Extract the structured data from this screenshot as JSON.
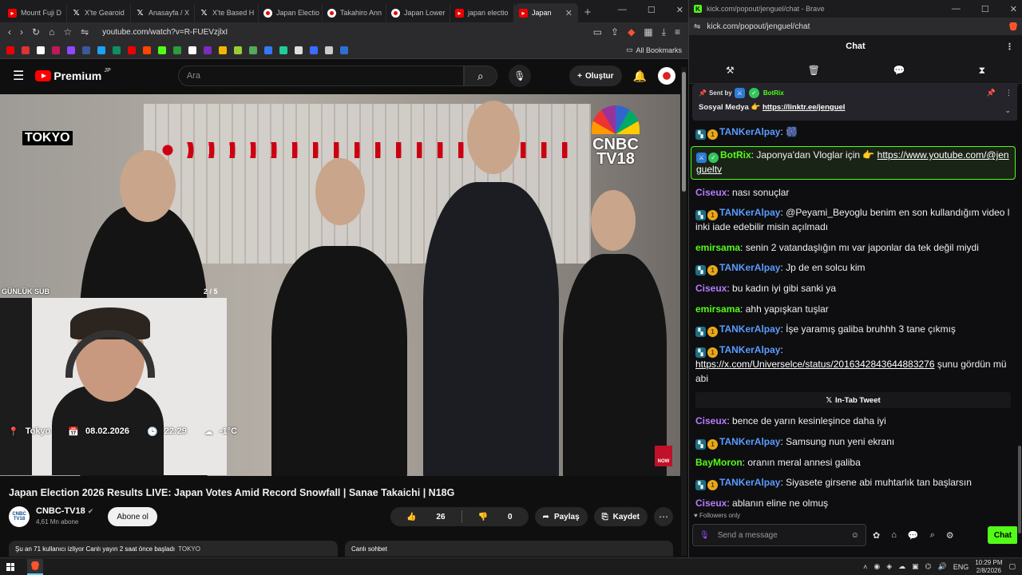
{
  "left_browser": {
    "tabs": [
      {
        "label": "Mount Fuji D",
        "icon": "youtube-icon"
      },
      {
        "label": "X'te Gearoid",
        "icon": "x-icon"
      },
      {
        "label": "Anasayfa / X",
        "icon": "x-icon"
      },
      {
        "label": "X'te Based H",
        "icon": "x-icon"
      },
      {
        "label": "Japan Electio",
        "icon": "japan-flag-icon"
      },
      {
        "label": "Takahiro Ann",
        "icon": "japan-flag-icon"
      },
      {
        "label": "Japan Lower",
        "icon": "japan-flag-icon"
      },
      {
        "label": "japan electio",
        "icon": "youtube-icon"
      },
      {
        "label": "Japan",
        "icon": "youtube-icon",
        "active": true
      }
    ],
    "url": "youtube.com/watch?v=R-FUEVzjlxI",
    "all_bookmarks": "All Bookmarks"
  },
  "youtube": {
    "logo_text": "Premium",
    "logo_region": "JP",
    "search_placeholder": "Ara",
    "create_label": "Oluştur",
    "video": {
      "location_tag": "TOKYO",
      "broadcaster_line1": "CNBC",
      "broadcaster_line2": "TV18",
      "overlay_label": "GÜNLÜK SUB",
      "overlay_page": "2 / 5",
      "cam_status": {
        "city": "Tokyo",
        "date": "08.02.2026",
        "time": "22:29",
        "temp": "-1°C"
      },
      "now_badge": "NOW"
    },
    "title": "Japan Election 2026 Results LIVE: Japan Votes Amid Record Snowfall | Sanae Takaichi | N18G",
    "channel": {
      "name": "CNBC-TV18",
      "subs": "4,61 Mn abone",
      "avatar_text": "CNBC TV18"
    },
    "subscribe_label": "Abone ol",
    "likes": "26",
    "dislikes": "0",
    "share_label": "Paylaş",
    "save_label": "Kaydet",
    "live_info": "Şu an 71 kullanıcı izliyor  Canlı yayın 2 saat önce başladı",
    "live_tag": "TOKYO",
    "live_chat_label": "Canlı sohbet"
  },
  "right_browser": {
    "window_title": "kick.com/popout/jenguel/chat - Brave",
    "url": "kick.com/popout/jenguel/chat"
  },
  "chat": {
    "header": "Chat",
    "pinned": {
      "sent_by_label": "Sent by",
      "sender": "BotRix",
      "text": "Sosyal Medya 👉",
      "link": "https://linktr.ee/jenguel"
    },
    "messages": [
      {
        "user": "TANKerAlpay",
        "color": "#5b9bff",
        "badges": [
          "sub",
          "coin"
        ],
        "text": "🎆"
      },
      {
        "user": "BotRix",
        "color": "#53fc18",
        "badges": [
          "mod",
          "ver"
        ],
        "text": "Japonya'dan Vloglar için 👉 ",
        "link": "https://www.youtube.com/@jengueltv",
        "highlight": true
      },
      {
        "user": "Ciseux",
        "color": "#b77bff",
        "badges": [],
        "text": "nası sonuçlar"
      },
      {
        "user": "TANKerAlpay",
        "color": "#5b9bff",
        "badges": [
          "sub",
          "coin"
        ],
        "text": "@Peyami_Beyoglu benim en son kullandığım video linki iade edebilir misin açılmadı"
      },
      {
        "user": "emirsama",
        "color": "#53fc18",
        "badges": [],
        "text": "senin 2 vatandaşlığın mı var japonlar da tek değil miydi"
      },
      {
        "user": "TANKerAlpay",
        "color": "#5b9bff",
        "badges": [
          "sub",
          "coin"
        ],
        "text": "Jp de en solcu kim"
      },
      {
        "user": "Ciseux",
        "color": "#b77bff",
        "badges": [],
        "text": "bu kadın iyi gibi sanki ya"
      },
      {
        "user": "emirsama",
        "color": "#53fc18",
        "badges": [],
        "text": "ahh yapışkan tuşlar"
      },
      {
        "user": "TANKerAlpay",
        "color": "#5b9bff",
        "badges": [
          "sub",
          "coin"
        ],
        "text": "İşe yaramış galiba bruhhh 3 tane çıkmış"
      },
      {
        "user": "TANKerAlpay",
        "color": "#5b9bff",
        "badges": [
          "sub",
          "coin"
        ],
        "text": "",
        "link": "https://x.com/Universelce/status/2016342843644883276",
        "after": " şunu gördün mü abi",
        "tweet": "In-Tab Tweet"
      },
      {
        "user": "Ciseux",
        "color": "#b77bff",
        "badges": [],
        "text": "bence de yarın kesinleşince daha iyi"
      },
      {
        "user": "TANKerAlpay",
        "color": "#5b9bff",
        "badges": [
          "sub",
          "coin"
        ],
        "text": "Samsung nun yeni ekranı"
      },
      {
        "user": "BayMoron",
        "color": "#53fc18",
        "badges": [],
        "text": "oranın meral annesi galiba"
      },
      {
        "user": "TANKerAlpay",
        "color": "#5b9bff",
        "badges": [
          "sub",
          "coin"
        ],
        "text": "Siyasete girsene abi muhtarlık tan başlarsın"
      },
      {
        "user": "Ciseux",
        "color": "#b77bff",
        "badges": [],
        "text": "ablanın eline ne olmuş"
      }
    ],
    "followers_only": "Followers only",
    "input_placeholder": "Send a message",
    "send_label": "Chat"
  },
  "taskbar": {
    "lang": "ENG",
    "time": "10:29 PM",
    "date": "2/8/2026"
  },
  "colors": {
    "kick_green": "#53fc18",
    "youtube_red": "#ff0000"
  }
}
